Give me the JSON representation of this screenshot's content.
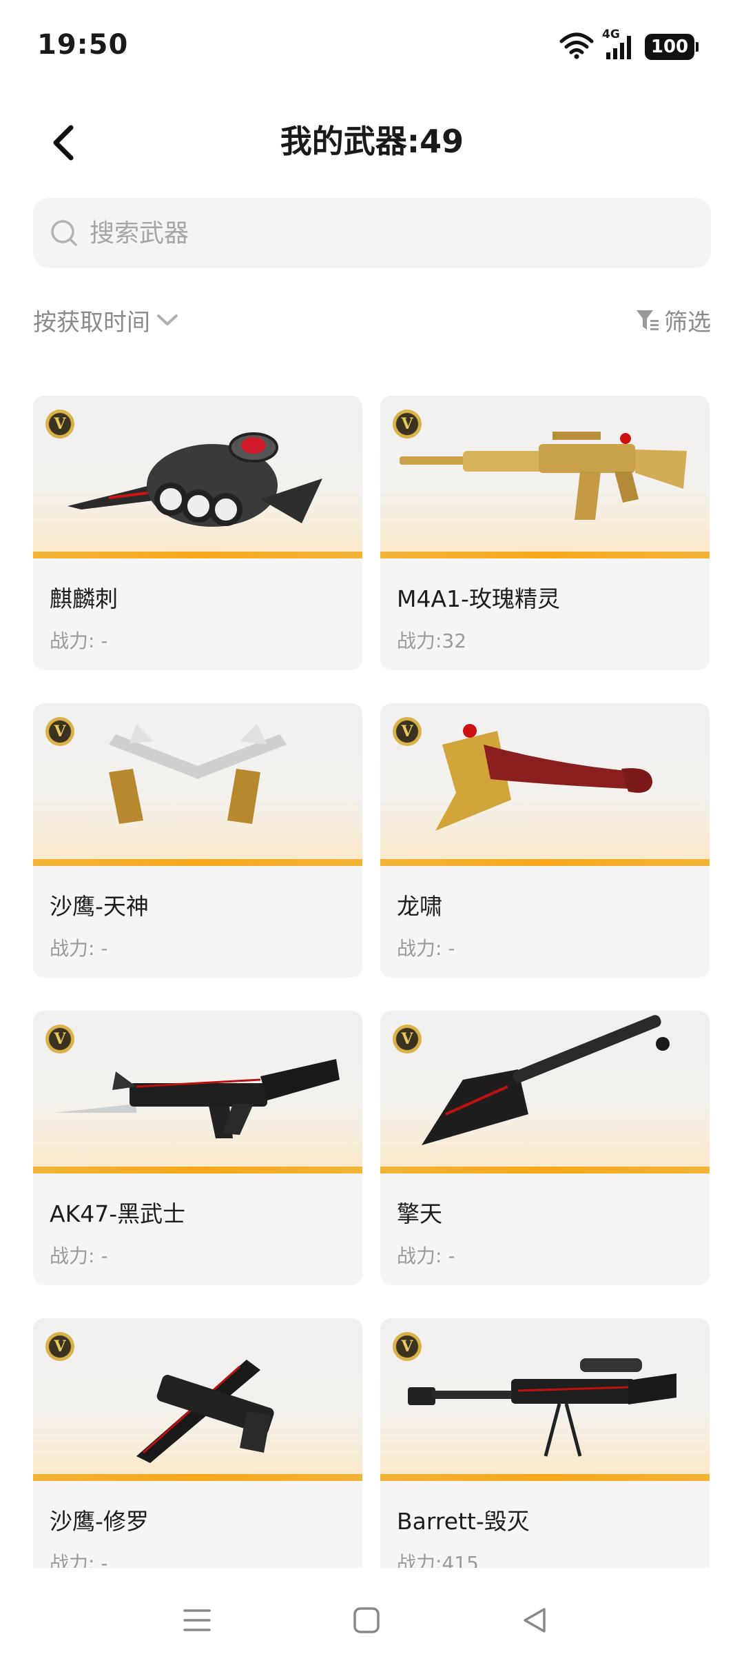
{
  "status_bar": {
    "time": "19:50",
    "network": "4G",
    "battery": "100"
  },
  "header": {
    "title": "我的武器:49"
  },
  "search": {
    "placeholder": "搜索武器"
  },
  "toolbar": {
    "sort_label": "按获取时间",
    "filter_label": "筛选"
  },
  "badge_letter": "V",
  "weapons": [
    {
      "name": "麒麟刺",
      "power": "战力: -"
    },
    {
      "name": "M4A1-玫瑰精灵",
      "power": "战力:32"
    },
    {
      "name": "沙鹰-天神",
      "power": "战力: -"
    },
    {
      "name": "龙啸",
      "power": "战力: -"
    },
    {
      "name": "AK47-黑武士",
      "power": "战力: -"
    },
    {
      "name": "擎天",
      "power": "战力: -"
    },
    {
      "name": "沙鹰-修罗",
      "power": "战力: -"
    },
    {
      "name": "Barrett-毁灭",
      "power": "战力:415"
    }
  ],
  "colors": {
    "accent_gold": "#f7a81b",
    "muted_text": "#8a8a8a",
    "card_bg": "#f5f5f5"
  }
}
